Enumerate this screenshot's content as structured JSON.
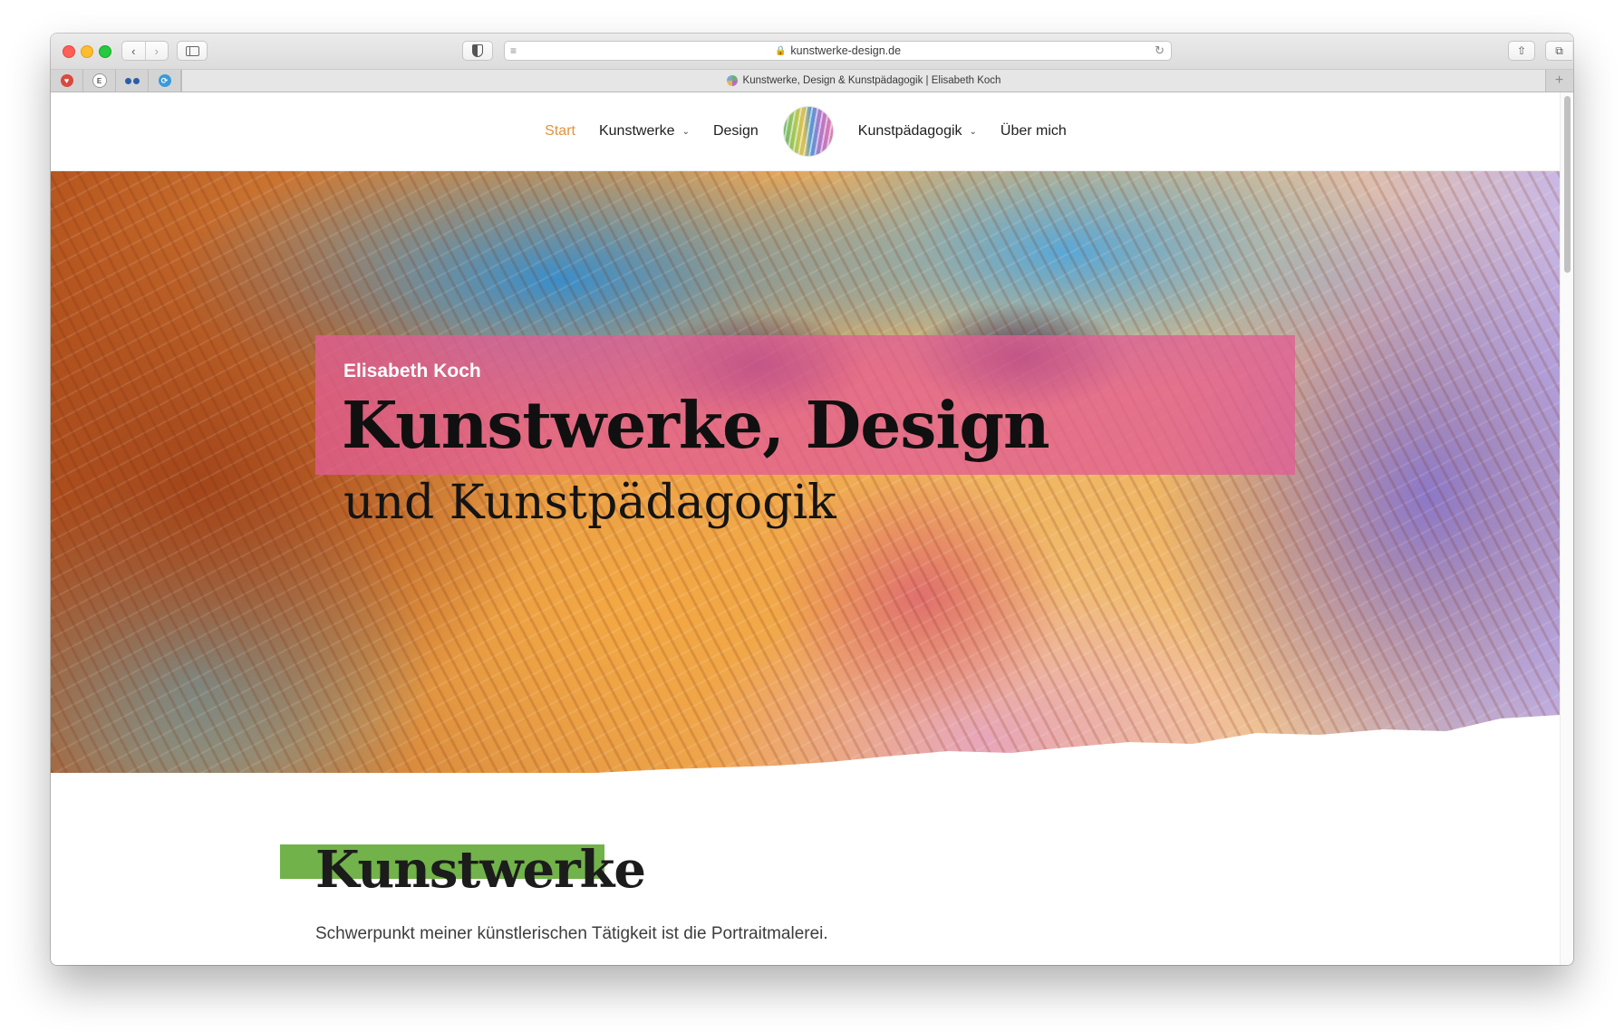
{
  "browser": {
    "url": "kunstwerke-design.de",
    "tab_title": "Kunstwerke, Design & Kunstpädagogik | Elisabeth Koch"
  },
  "nav": {
    "items": [
      {
        "label": "Start",
        "active": true
      },
      {
        "label": "Kunstwerke",
        "dropdown": true
      },
      {
        "label": "Design"
      },
      {
        "label": "Kunstpädagogik",
        "dropdown": true
      },
      {
        "label": "Über mich"
      }
    ],
    "active_color": "#e0923d"
  },
  "hero": {
    "name": "Elisabeth Koch",
    "title": "Kunstwerke, Design",
    "subtitle": "und Kunstpädagogik",
    "box_color": "#e25e93"
  },
  "section": {
    "title": "Kunstwerke",
    "text": "Schwerpunkt meiner künstlerischen Tätigkeit ist die Portraitmalerei.",
    "accent_color": "#72b24a"
  }
}
